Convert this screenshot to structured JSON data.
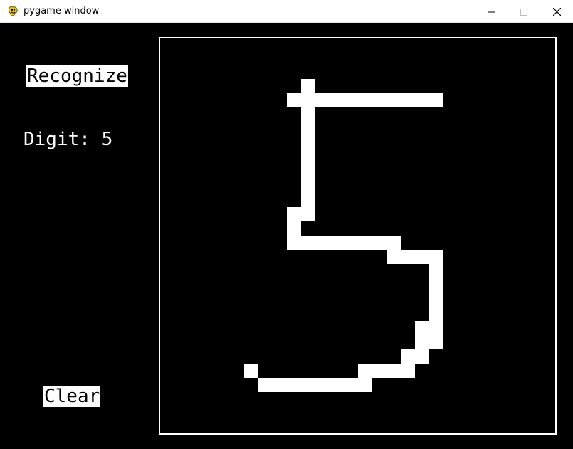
{
  "window": {
    "title": "pygame window",
    "app_icon": "pygame-snake-icon",
    "controls": {
      "minimize_icon": "minimize-icon",
      "maximize_icon": "maximize-icon",
      "close_icon": "close-icon"
    }
  },
  "app": {
    "recognize_label": "Recognize",
    "digit_label": "Digit: 5",
    "clear_label": "Clear"
  },
  "canvas": {
    "background": "#000000",
    "stroke_color": "#ffffff",
    "grid_size": 28,
    "filled_cells": [
      [
        10,
        4
      ],
      [
        9,
        5
      ],
      [
        10,
        5
      ],
      [
        11,
        5
      ],
      [
        12,
        5
      ],
      [
        13,
        5
      ],
      [
        14,
        5
      ],
      [
        15,
        5
      ],
      [
        16,
        5
      ],
      [
        17,
        5
      ],
      [
        18,
        5
      ],
      [
        19,
        5
      ],
      [
        10,
        6
      ],
      [
        10,
        7
      ],
      [
        10,
        8
      ],
      [
        10,
        9
      ],
      [
        10,
        10
      ],
      [
        10,
        11
      ],
      [
        10,
        12
      ],
      [
        10,
        13
      ],
      [
        9,
        13
      ],
      [
        10,
        13
      ],
      [
        9,
        14
      ],
      [
        9,
        15
      ],
      [
        10,
        15
      ],
      [
        11,
        15
      ],
      [
        12,
        15
      ],
      [
        13,
        15
      ],
      [
        14,
        15
      ],
      [
        15,
        15
      ],
      [
        16,
        15
      ],
      [
        16,
        16
      ],
      [
        17,
        16
      ],
      [
        18,
        16
      ],
      [
        19,
        16
      ],
      [
        19,
        17
      ],
      [
        19,
        18
      ],
      [
        19,
        19
      ],
      [
        19,
        20
      ],
      [
        19,
        21
      ],
      [
        18,
        21
      ],
      [
        18,
        22
      ],
      [
        19,
        22
      ],
      [
        17,
        23
      ],
      [
        18,
        23
      ],
      [
        14,
        24
      ],
      [
        15,
        24
      ],
      [
        16,
        24
      ],
      [
        17,
        24
      ],
      [
        6,
        24
      ],
      [
        7,
        25
      ],
      [
        8,
        25
      ],
      [
        9,
        25
      ],
      [
        10,
        25
      ],
      [
        11,
        25
      ],
      [
        12,
        25
      ],
      [
        13,
        25
      ],
      [
        14,
        25
      ]
    ]
  }
}
